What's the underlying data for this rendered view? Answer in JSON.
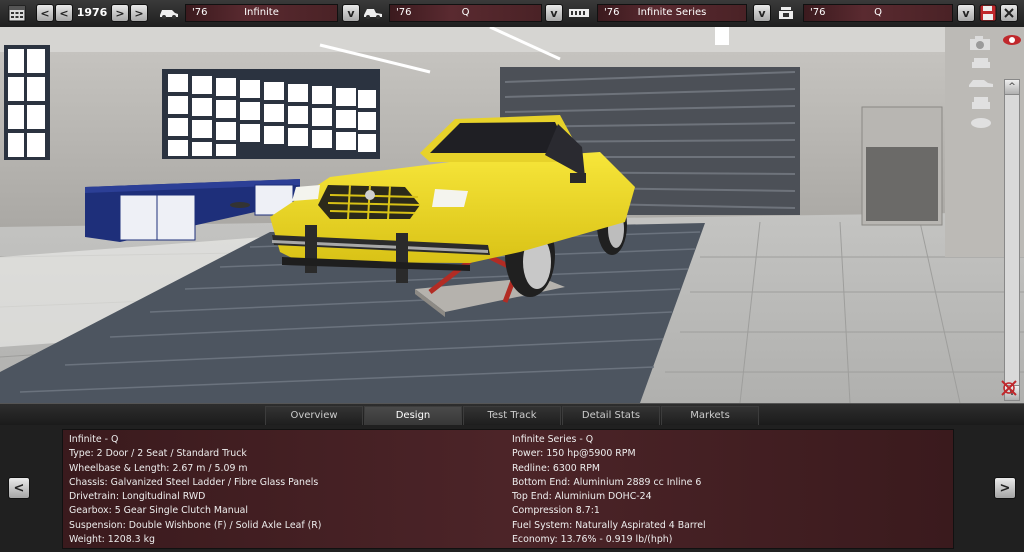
{
  "topbar": {
    "year": "1976",
    "prev_label": "<",
    "first_label": "<",
    "next_label": ">",
    "last_label": ">",
    "dropdown_label": "v",
    "selectors": [
      {
        "year": "'76",
        "name": "Infinite"
      },
      {
        "year": "'76",
        "name": "Q"
      },
      {
        "year": "'76",
        "name": "Infinite Series"
      },
      {
        "year": "'76",
        "name": "Q"
      }
    ]
  },
  "scroll": {
    "up_label": "^",
    "down_label": "v"
  },
  "tabs": [
    {
      "label": "Overview"
    },
    {
      "label": "Design",
      "active": true
    },
    {
      "label": "Test Track"
    },
    {
      "label": "Detail Stats"
    },
    {
      "label": "Markets"
    }
  ],
  "bottom_nav": {
    "prev_label": "<",
    "next_label": ">"
  },
  "stats": {
    "left": [
      "Infinite - Q",
      "Type: 2 Door / 2 Seat / Standard Truck",
      "Wheelbase & Length: 2.67 m / 5.09 m",
      "Chassis: Galvanized Steel Ladder / Fibre Glass Panels",
      "Drivetrain: Longitudinal RWD",
      "Gearbox: 5 Gear Single Clutch Manual",
      "Suspension: Double Wishbone (F) / Solid Axle Leaf (R)",
      "Weight: 1208.3 kg"
    ],
    "right": [
      "Infinite Series - Q",
      "Power: 150 hp@5900 RPM",
      "Redline: 6300 RPM",
      "Bottom End: Aluminium 2889 cc Inline 6",
      "Top End: Aluminium DOHC-24",
      "Compression 8.7:1",
      "Fuel System: Naturally Aspirated 4 Barrel",
      "Economy: 13.76% - 0.919 lb/(hph)"
    ]
  },
  "colors": {
    "car": "#f2dc25",
    "panel": "#4a2226",
    "accent_red": "#c0282c"
  }
}
